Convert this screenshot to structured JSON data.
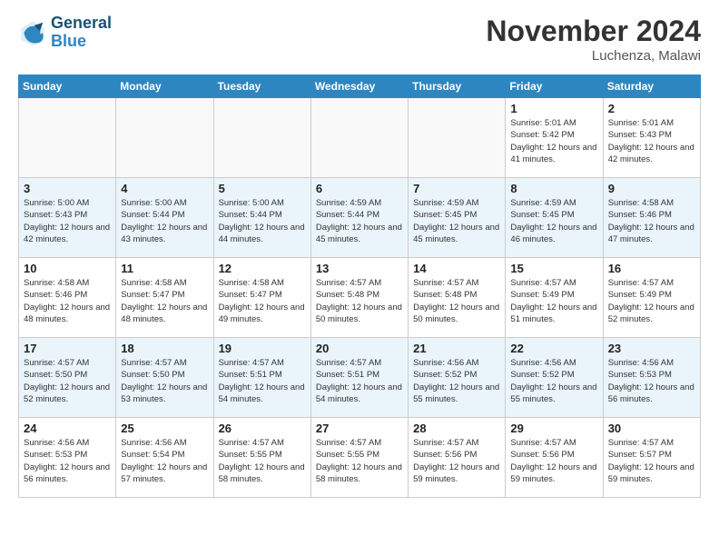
{
  "header": {
    "logo_line1": "General",
    "logo_line2": "Blue",
    "month": "November 2024",
    "location": "Luchenza, Malawi"
  },
  "weekdays": [
    "Sunday",
    "Monday",
    "Tuesday",
    "Wednesday",
    "Thursday",
    "Friday",
    "Saturday"
  ],
  "weeks": [
    [
      {
        "day": "",
        "info": ""
      },
      {
        "day": "",
        "info": ""
      },
      {
        "day": "",
        "info": ""
      },
      {
        "day": "",
        "info": ""
      },
      {
        "day": "",
        "info": ""
      },
      {
        "day": "1",
        "info": "Sunrise: 5:01 AM\nSunset: 5:42 PM\nDaylight: 12 hours and 41 minutes."
      },
      {
        "day": "2",
        "info": "Sunrise: 5:01 AM\nSunset: 5:43 PM\nDaylight: 12 hours and 42 minutes."
      }
    ],
    [
      {
        "day": "3",
        "info": "Sunrise: 5:00 AM\nSunset: 5:43 PM\nDaylight: 12 hours and 42 minutes."
      },
      {
        "day": "4",
        "info": "Sunrise: 5:00 AM\nSunset: 5:44 PM\nDaylight: 12 hours and 43 minutes."
      },
      {
        "day": "5",
        "info": "Sunrise: 5:00 AM\nSunset: 5:44 PM\nDaylight: 12 hours and 44 minutes."
      },
      {
        "day": "6",
        "info": "Sunrise: 4:59 AM\nSunset: 5:44 PM\nDaylight: 12 hours and 45 minutes."
      },
      {
        "day": "7",
        "info": "Sunrise: 4:59 AM\nSunset: 5:45 PM\nDaylight: 12 hours and 45 minutes."
      },
      {
        "day": "8",
        "info": "Sunrise: 4:59 AM\nSunset: 5:45 PM\nDaylight: 12 hours and 46 minutes."
      },
      {
        "day": "9",
        "info": "Sunrise: 4:58 AM\nSunset: 5:46 PM\nDaylight: 12 hours and 47 minutes."
      }
    ],
    [
      {
        "day": "10",
        "info": "Sunrise: 4:58 AM\nSunset: 5:46 PM\nDaylight: 12 hours and 48 minutes."
      },
      {
        "day": "11",
        "info": "Sunrise: 4:58 AM\nSunset: 5:47 PM\nDaylight: 12 hours and 48 minutes."
      },
      {
        "day": "12",
        "info": "Sunrise: 4:58 AM\nSunset: 5:47 PM\nDaylight: 12 hours and 49 minutes."
      },
      {
        "day": "13",
        "info": "Sunrise: 4:57 AM\nSunset: 5:48 PM\nDaylight: 12 hours and 50 minutes."
      },
      {
        "day": "14",
        "info": "Sunrise: 4:57 AM\nSunset: 5:48 PM\nDaylight: 12 hours and 50 minutes."
      },
      {
        "day": "15",
        "info": "Sunrise: 4:57 AM\nSunset: 5:49 PM\nDaylight: 12 hours and 51 minutes."
      },
      {
        "day": "16",
        "info": "Sunrise: 4:57 AM\nSunset: 5:49 PM\nDaylight: 12 hours and 52 minutes."
      }
    ],
    [
      {
        "day": "17",
        "info": "Sunrise: 4:57 AM\nSunset: 5:50 PM\nDaylight: 12 hours and 52 minutes."
      },
      {
        "day": "18",
        "info": "Sunrise: 4:57 AM\nSunset: 5:50 PM\nDaylight: 12 hours and 53 minutes."
      },
      {
        "day": "19",
        "info": "Sunrise: 4:57 AM\nSunset: 5:51 PM\nDaylight: 12 hours and 54 minutes."
      },
      {
        "day": "20",
        "info": "Sunrise: 4:57 AM\nSunset: 5:51 PM\nDaylight: 12 hours and 54 minutes."
      },
      {
        "day": "21",
        "info": "Sunrise: 4:56 AM\nSunset: 5:52 PM\nDaylight: 12 hours and 55 minutes."
      },
      {
        "day": "22",
        "info": "Sunrise: 4:56 AM\nSunset: 5:52 PM\nDaylight: 12 hours and 55 minutes."
      },
      {
        "day": "23",
        "info": "Sunrise: 4:56 AM\nSunset: 5:53 PM\nDaylight: 12 hours and 56 minutes."
      }
    ],
    [
      {
        "day": "24",
        "info": "Sunrise: 4:56 AM\nSunset: 5:53 PM\nDaylight: 12 hours and 56 minutes."
      },
      {
        "day": "25",
        "info": "Sunrise: 4:56 AM\nSunset: 5:54 PM\nDaylight: 12 hours and 57 minutes."
      },
      {
        "day": "26",
        "info": "Sunrise: 4:57 AM\nSunset: 5:55 PM\nDaylight: 12 hours and 58 minutes."
      },
      {
        "day": "27",
        "info": "Sunrise: 4:57 AM\nSunset: 5:55 PM\nDaylight: 12 hours and 58 minutes."
      },
      {
        "day": "28",
        "info": "Sunrise: 4:57 AM\nSunset: 5:56 PM\nDaylight: 12 hours and 59 minutes."
      },
      {
        "day": "29",
        "info": "Sunrise: 4:57 AM\nSunset: 5:56 PM\nDaylight: 12 hours and 59 minutes."
      },
      {
        "day": "30",
        "info": "Sunrise: 4:57 AM\nSunset: 5:57 PM\nDaylight: 12 hours and 59 minutes."
      }
    ]
  ]
}
